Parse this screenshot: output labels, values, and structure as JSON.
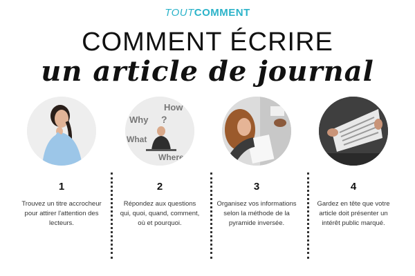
{
  "logo": {
    "part1": "TOUT",
    "part2": "COMMENT"
  },
  "title": {
    "line1": "COMMENT ÉCRIRE",
    "line2": "un article de journal"
  },
  "steps": [
    {
      "number": "1",
      "text": "Trouvez un titre accrocheur pour attirer l'attention des lecteurs."
    },
    {
      "number": "2",
      "text": "Répondez aux questions qui, quoi, quand, comment, où et pourquoi."
    },
    {
      "number": "3",
      "text": "Organisez vos informations selon la méthode de la pyramide inversée."
    },
    {
      "number": "4",
      "text": "Gardez en tête que votre article doit présenter un intérêt public marqué."
    }
  ],
  "image_words": [
    "How",
    "Why",
    "?",
    "What",
    "Where"
  ],
  "colors": {
    "brand": "#2bb3c9",
    "text": "#222222"
  }
}
